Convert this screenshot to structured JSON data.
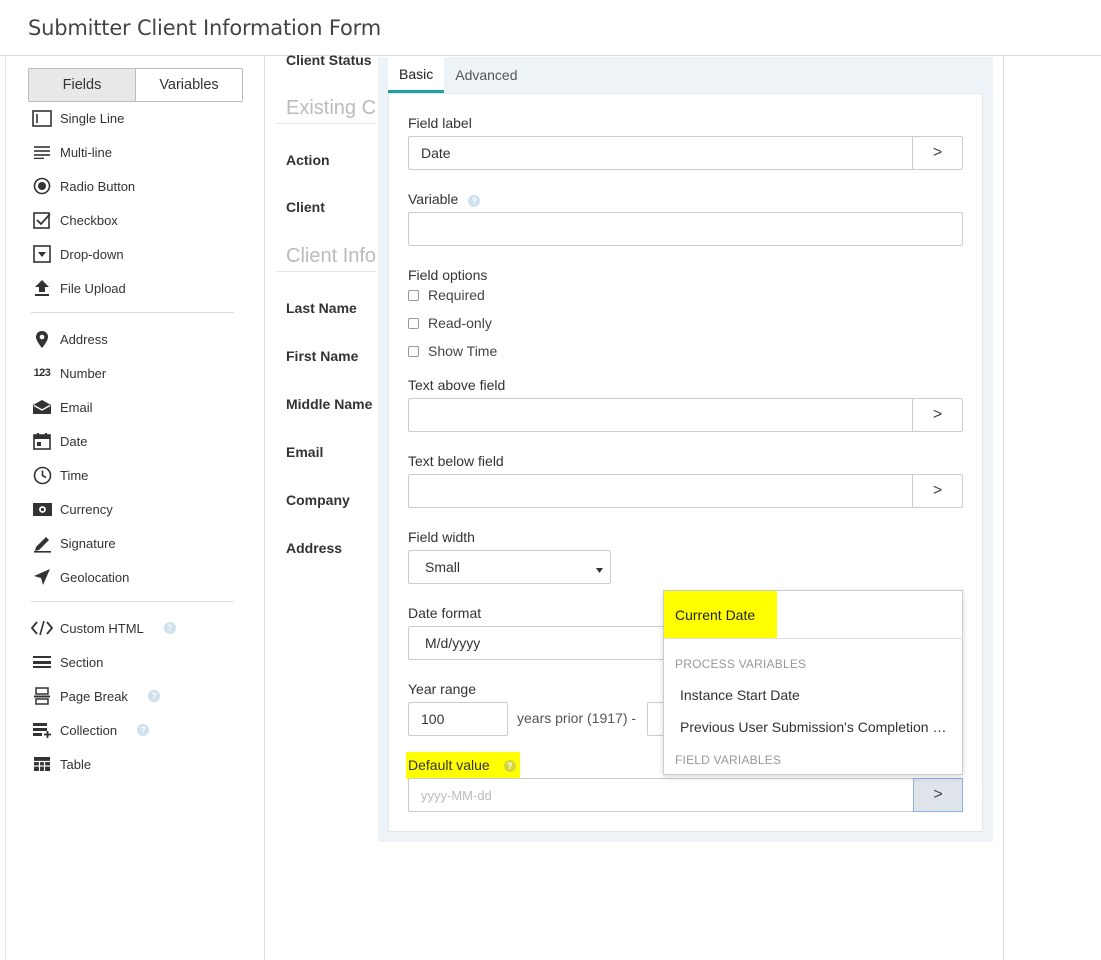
{
  "app": {
    "title": "Submitter Client Information Form"
  },
  "sidebar": {
    "tabs": [
      {
        "label": "Fields"
      },
      {
        "label": "Variables"
      }
    ],
    "items": [
      {
        "label": "Single Line",
        "icon": "single-line-icon"
      },
      {
        "label": "Multi-line",
        "icon": "multi-line-icon"
      },
      {
        "label": "Radio Button",
        "icon": "radio-button-icon"
      },
      {
        "label": "Checkbox",
        "icon": "checkbox-icon"
      },
      {
        "label": "Drop-down",
        "icon": "dropdown-icon"
      },
      {
        "label": "File Upload",
        "icon": "upload-icon"
      },
      {
        "label": "Address",
        "icon": "map-pin-icon"
      },
      {
        "label": "Number",
        "icon": "number-icon"
      },
      {
        "label": "Email",
        "icon": "envelope-icon"
      },
      {
        "label": "Date",
        "icon": "calendar-icon"
      },
      {
        "label": "Time",
        "icon": "clock-icon"
      },
      {
        "label": "Currency",
        "icon": "banknote-icon"
      },
      {
        "label": "Signature",
        "icon": "pen-icon"
      },
      {
        "label": "Geolocation",
        "icon": "location-arrow-icon"
      },
      {
        "label": "Custom HTML",
        "icon": "code-icon"
      },
      {
        "label": "Section",
        "icon": "section-icon"
      },
      {
        "label": "Page Break",
        "icon": "page-break-icon"
      },
      {
        "label": "Collection",
        "icon": "collection-icon"
      },
      {
        "label": "Table",
        "icon": "table-icon"
      }
    ],
    "number_glyph": "123"
  },
  "canvas": {
    "labels": {
      "client_status": "Client Status",
      "action": "Action",
      "client": "Client",
      "last_name": "Last Name",
      "first_name": "First Name",
      "middle_name": "Middle Name",
      "email": "Email",
      "company": "Company",
      "address": "Address"
    },
    "sections": {
      "existing": "Existing Client",
      "client_info": "Client Info"
    }
  },
  "properties": {
    "tabs": [
      {
        "label": "Basic"
      },
      {
        "label": "Advanced"
      }
    ],
    "field_label": {
      "label": "Field label",
      "value": "Date"
    },
    "variable": {
      "label": "Variable",
      "value": ""
    },
    "field_options": {
      "label": "Field options",
      "required": "Required",
      "read_only": "Read-only",
      "show_time": "Show Time"
    },
    "text_above": {
      "label": "Text above field",
      "value": ""
    },
    "text_below": {
      "label": "Text below field",
      "value": ""
    },
    "field_width": {
      "label": "Field width",
      "value": "Small"
    },
    "date_format": {
      "label": "Date format",
      "value": "M/d/yyyy"
    },
    "year_range": {
      "label": "Year range",
      "value": "100",
      "suffix": "years prior (1917) -"
    },
    "default_value": {
      "label": "Default value",
      "placeholder": "yyyy-MM-dd"
    },
    "chevron": ">"
  },
  "dropdown": {
    "current": "Current Date",
    "process_header": "PROCESS VARIABLES",
    "process_items": [
      "Instance Start Date",
      "Previous User Submission's Completion Date"
    ],
    "field_header": "FIELD VARIABLES"
  },
  "colors": {
    "accent": "#1aa3a3",
    "highlight": "#ffff00",
    "panel_bg": "#eef3f8"
  }
}
